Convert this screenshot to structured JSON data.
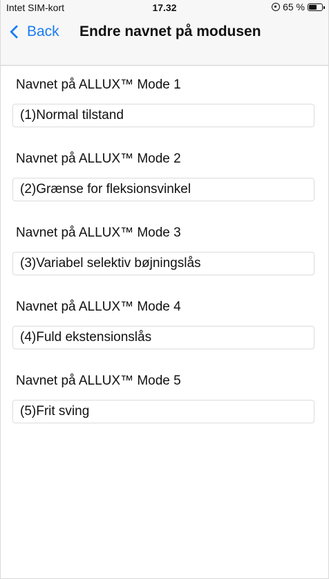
{
  "status_bar": {
    "carrier": "Intet SIM-kort",
    "time": "17.32",
    "battery": "65 %",
    "battery_level": 0.65
  },
  "nav": {
    "back_label": "Back",
    "title": "Endre navnet på modusen"
  },
  "colors": {
    "accent": "#1a7cf4",
    "bar_background": "#f7f7f7"
  },
  "fields": [
    {
      "label": "Navnet på ALLUX™ Mode 1",
      "value": "(1)Normal tilstand"
    },
    {
      "label": "Navnet på ALLUX™ Mode 2",
      "value": "(2)Grænse for fleksionsvinkel"
    },
    {
      "label": "Navnet på ALLUX™ Mode 3",
      "value": "(3)Variabel selektiv bøjningslås"
    },
    {
      "label": "Navnet på ALLUX™ Mode 4",
      "value": "(4)Fuld ekstensionslås"
    },
    {
      "label": "Navnet på ALLUX™ Mode 5",
      "value": "(5)Frit sving"
    }
  ]
}
